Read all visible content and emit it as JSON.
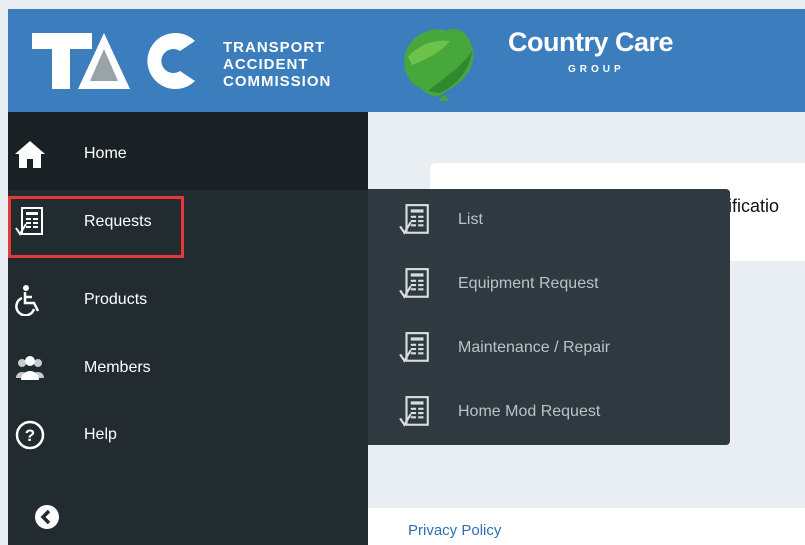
{
  "header": {
    "tac_letters": "TAC",
    "tac_subtitle": [
      "TRANSPORT",
      "ACCIDENT",
      "COMMISSION"
    ],
    "brand_title": "Country Care",
    "brand_subtitle": "GROUP",
    "colors": {
      "bar": "#3b7dbd",
      "green": "#3fae3f"
    }
  },
  "sidebar": {
    "items": [
      {
        "label": "Home",
        "icon": "home-icon"
      },
      {
        "label": "Requests",
        "icon": "document-check-icon",
        "highlighted": true
      },
      {
        "label": "Products",
        "icon": "wheelchair-icon"
      },
      {
        "label": "Members",
        "icon": "users-icon"
      },
      {
        "label": "Help",
        "icon": "question-circle-icon"
      }
    ],
    "collapse_icon": "chevron-left-circle-icon",
    "highlight_color": "#e53935"
  },
  "submenu": {
    "items": [
      {
        "label": "List",
        "icon": "document-check-icon"
      },
      {
        "label": "Equipment Request",
        "icon": "document-check-icon"
      },
      {
        "label": "Maintenance / Repair",
        "icon": "document-check-icon"
      },
      {
        "label": "Home Mod Request",
        "icon": "document-check-icon"
      }
    ]
  },
  "content": {
    "card_partial_text": "tificatio"
  },
  "footer": {
    "privacy_link": "Privacy Policy"
  }
}
